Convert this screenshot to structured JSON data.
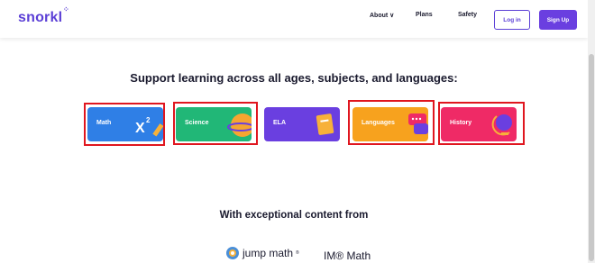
{
  "header": {
    "logo": "snorkl",
    "nav": {
      "about": "About ∨",
      "plans": "Plans",
      "safety": "Safety"
    },
    "login_label": "Log in",
    "signup_label": "Sign Up"
  },
  "main": {
    "heading": "Support learning across all ages, subjects, and languages:",
    "subjects": [
      {
        "label": "Math",
        "color": "#2f7fe6",
        "icon": "x-squared-pencil-icon"
      },
      {
        "label": "Science",
        "color": "#21b777",
        "icon": "planet-icon"
      },
      {
        "label": "ELA",
        "color": "#6a3fe0",
        "icon": "book-icon"
      },
      {
        "label": "Languages",
        "color": "#f7a21e",
        "icon": "speech-bubbles-icon"
      },
      {
        "label": "History",
        "color": "#ef2a66",
        "icon": "globe-icon"
      }
    ],
    "content_heading": "With exceptional content from",
    "partners": {
      "jumpmath": "jump math",
      "jumpmath_tm": "®",
      "im_math": "IM® Math"
    }
  },
  "colors": {
    "brand": "#5b3fd6",
    "highlight_frame": "#e0161f"
  }
}
